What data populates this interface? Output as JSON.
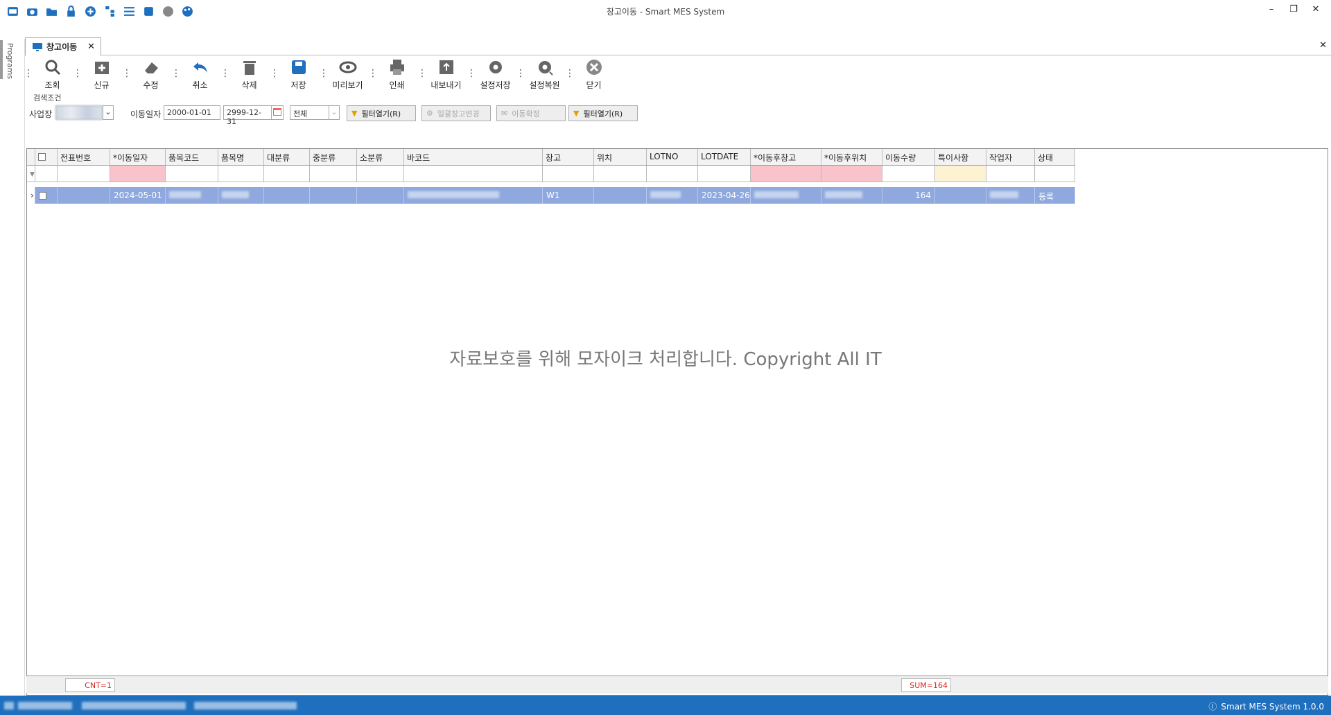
{
  "window": {
    "title": "창고이동 - Smart MES System"
  },
  "quick_access": [
    "screenshot-icon",
    "camera-icon",
    "folder-icon",
    "lock-icon",
    "add-circle-icon",
    "tree-icon",
    "list-icon",
    "window-icon",
    "palette-icon",
    "palette-alt-icon"
  ],
  "window_controls": {
    "minimize": "–",
    "restore": "❐",
    "close": "✕"
  },
  "left_rail": {
    "label": "Programs"
  },
  "tabs": {
    "active": "창고이동",
    "close": "✕",
    "strip_close": "✕"
  },
  "toolbar": [
    {
      "label": "조회",
      "icon": "search-icon"
    },
    {
      "label": "신규",
      "icon": "new-icon"
    },
    {
      "label": "수정",
      "icon": "eraser-icon"
    },
    {
      "label": "취소",
      "icon": "undo-icon"
    },
    {
      "label": "삭제",
      "icon": "trash-icon"
    },
    {
      "label": "저장",
      "icon": "save-icon"
    },
    {
      "label": "미리보기",
      "icon": "eye-icon"
    },
    {
      "label": "인쇄",
      "icon": "print-icon"
    },
    {
      "label": "내보내기",
      "icon": "export-icon"
    },
    {
      "label": "설정저장",
      "icon": "gear-icon"
    },
    {
      "label": "설정복원",
      "icon": "gear-restore-icon"
    },
    {
      "label": "닫기",
      "icon": "close-circle-icon"
    }
  ],
  "search": {
    "legend": "검색조건",
    "site_label": "사업장",
    "date_label": "이동일자",
    "date_from": "2000-01-01",
    "date_to": "2999-12-31",
    "status_value": "전체",
    "filter_btn1": "필터열기(R)",
    "bulk_btn": "일괄창고변경",
    "confirm_btn": "이동확정",
    "filter_btn2": "필터열기(R)"
  },
  "grid": {
    "columns": [
      "전표번호",
      "*이동일자",
      "품목코드",
      "품목명",
      "대분류",
      "중분류",
      "소분류",
      "바코드",
      "창고",
      "위치",
      "LOTNO",
      "LOTDATE",
      "*이동후창고",
      "*이동후위치",
      "이동수량",
      "특이사항",
      "작업자",
      "상태"
    ],
    "rows": [
      {
        "slip": "",
        "move_date": "2024-05-01",
        "item_code": "",
        "item_name": "",
        "cat1": "",
        "cat2": "",
        "cat3": "",
        "barcode": "",
        "warehouse": "W1",
        "location": "",
        "lotno": "",
        "lotdate": "2023-04-26",
        "to_wh": "",
        "to_loc": "",
        "qty": "164",
        "note": "",
        "worker": "",
        "status": "등록"
      }
    ],
    "footer": {
      "count": "CNT=1",
      "sum": "SUM=164"
    }
  },
  "watermark": "자료보호를 위해 모자이크 처리합니다. Copyright All IT",
  "status": {
    "app_version": "Smart MES System 1.0.0"
  },
  "colors": {
    "accent": "#1f6fbf",
    "selected_row": "#8fa9de",
    "required": "#f9c3cb"
  }
}
